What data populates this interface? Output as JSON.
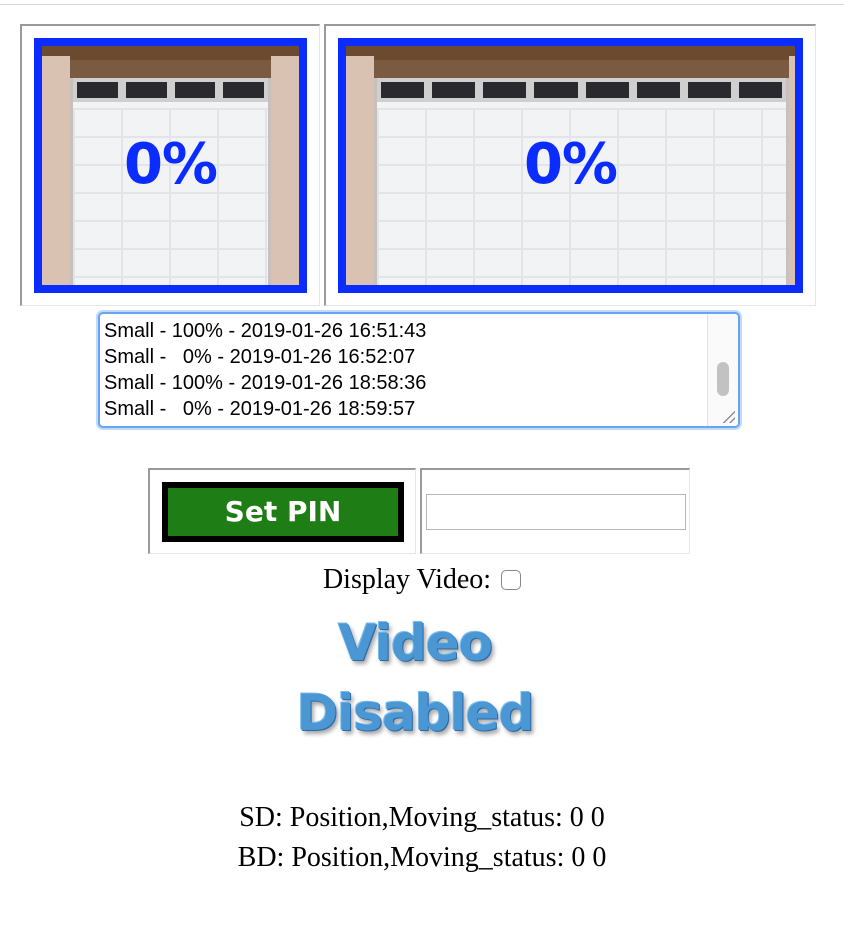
{
  "doors": {
    "small": {
      "percent_text": "0%",
      "percent": 0
    },
    "big": {
      "percent_text": "0%",
      "percent": 0
    }
  },
  "log": {
    "lines": [
      "Small - 100% - 2019-01-26 16:51:43",
      "Small -   0% - 2019-01-26 16:52:07",
      "Small - 100% - 2019-01-26 18:58:36",
      "Small -   0% - 2019-01-26 18:59:57"
    ]
  },
  "pin": {
    "button_label": "Set PIN",
    "input_value": ""
  },
  "video": {
    "label": "Display Video:",
    "checked": false,
    "disabled_line1": "Video",
    "disabled_line2": "Disabled"
  },
  "status": {
    "sd": "SD: Position,Moving_status: 0 0",
    "bd": "BD: Position,Moving_status: 0 0"
  },
  "colors": {
    "door_border": "#0a2cff",
    "pin_button": "#1e7d14"
  }
}
